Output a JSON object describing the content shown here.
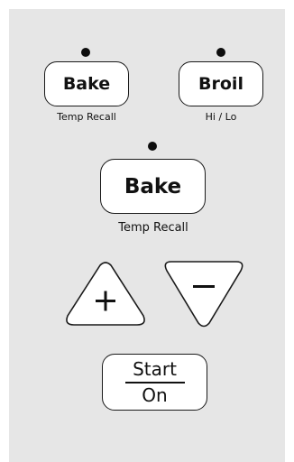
{
  "keys": {
    "bake_small": {
      "label": "Bake",
      "sublabel": "Temp Recall"
    },
    "broil": {
      "label": "Broil",
      "sublabel": "Hi / Lo"
    },
    "bake_large": {
      "label": "Bake",
      "sublabel": "Temp Recall"
    },
    "increase": {
      "icon": "plus-icon"
    },
    "decrease": {
      "icon": "minus-icon"
    },
    "start": {
      "label_top": "Start",
      "label_bottom": "On"
    }
  },
  "colors": {
    "panel": "#e6e6e6",
    "key_face": "#ffffff",
    "key_outline": "#1a1a1a",
    "indicator": "#0d0d0d"
  }
}
